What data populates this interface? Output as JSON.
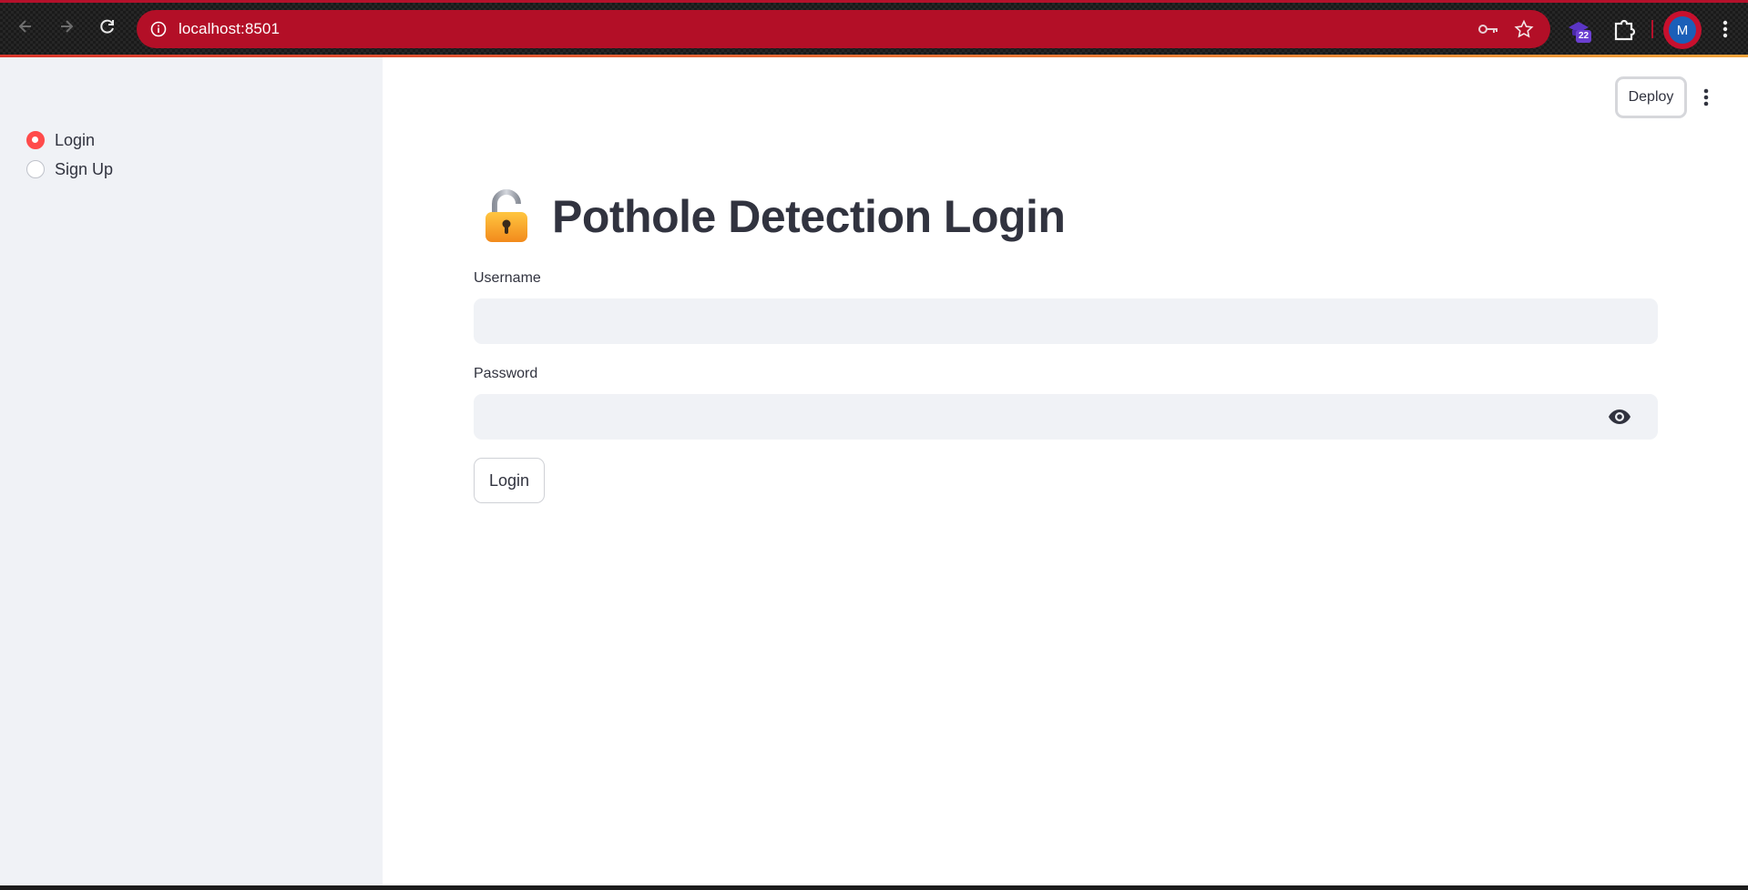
{
  "browser": {
    "url": "localhost:8501",
    "extension_badge": "22",
    "profile_initial": "M"
  },
  "header": {
    "deploy_label": "Deploy"
  },
  "sidebar": {
    "radio_options": [
      {
        "label": "Login",
        "checked": true
      },
      {
        "label": "Sign Up",
        "checked": false
      }
    ]
  },
  "main": {
    "title": "Pothole Detection Login",
    "title_icon": "lock-icon",
    "username_label": "Username",
    "username_value": "",
    "password_label": "Password",
    "password_value": "",
    "login_button": "Login"
  },
  "colors": {
    "omnibox": "#b30f27",
    "accent": "#ff4b4b",
    "sidebar_bg": "#f0f2f6",
    "text": "#31333f"
  }
}
